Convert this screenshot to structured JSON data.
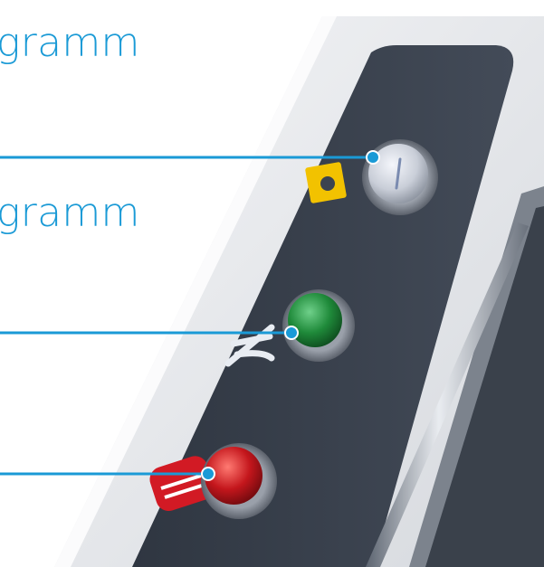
{
  "captions": [
    {
      "text": "gramm"
    },
    {
      "text": "gramm"
    }
  ],
  "panel": {
    "buttons": [
      {
        "icon": "tool-insert-icon",
        "button_color": "#c9ced8",
        "icon_color": "#f2c200"
      },
      {
        "icon": "coolant-spray-icon",
        "button_color": "#1f8a3a",
        "icon_color": "#e8ecf2"
      },
      {
        "icon": "stop-icon",
        "button_color": "#c4161c",
        "icon_color": "#d21a24"
      }
    ]
  },
  "colors": {
    "leader_line": "#1a9ad6",
    "panel_face": "#3b4350",
    "housing": "#e6e8ec"
  }
}
